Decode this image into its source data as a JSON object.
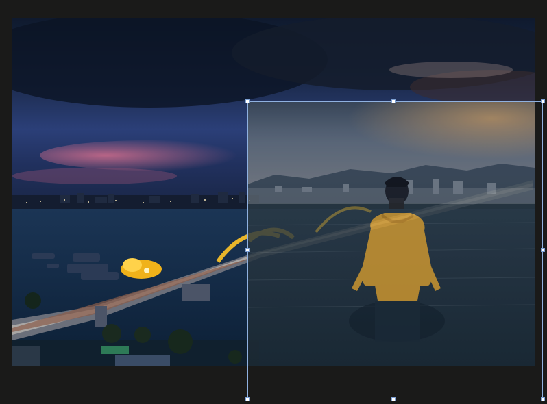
{
  "workspace": {
    "background_color": "#1a1a19",
    "selection_color": "#8fb1e0"
  },
  "layers": {
    "base": {
      "icon": "photo-city-bridge"
    },
    "overlay": {
      "icon": "photo-person-in-water",
      "opacity_percent": 82
    }
  },
  "transform_box": {
    "handles": [
      "top-left",
      "top-center",
      "top-right",
      "middle-left",
      "middle-right",
      "bottom-left",
      "bottom-center",
      "bottom-right"
    ]
  }
}
